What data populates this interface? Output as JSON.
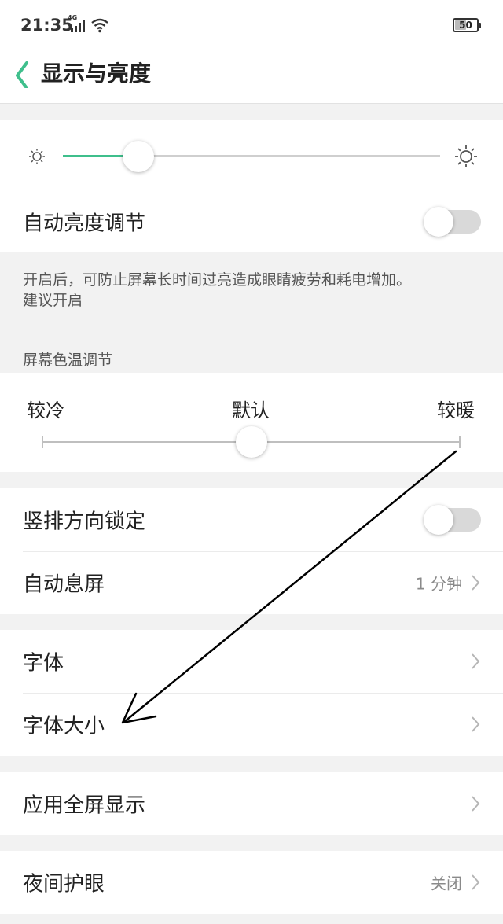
{
  "status_bar": {
    "time": "21:35",
    "network": "4G",
    "battery": "50"
  },
  "header": {
    "title": "显示与亮度"
  },
  "brightness": {
    "level": 0.2,
    "auto_label": "自动亮度调节",
    "auto_enabled": false
  },
  "auto_note": {
    "line1": "开启后，可防止屏幕长时间过亮造成眼睛疲劳和耗电增加。",
    "line2": "建议开启"
  },
  "color_temp": {
    "title": "屏幕色温调节",
    "cool": "较冷",
    "default": "默认",
    "warm": "较暖",
    "level": 0.5
  },
  "orientation": {
    "label": "竖排方向锁定",
    "enabled": false
  },
  "auto_sleep": {
    "label": "自动息屏",
    "value": "1 分钟"
  },
  "font": {
    "label": "字体"
  },
  "font_size": {
    "label": "字体大小"
  },
  "fullscreen": {
    "label": "应用全屏显示"
  },
  "night_mode": {
    "label": "夜间护眼",
    "value": "关闭"
  },
  "colors": {
    "accent": "#3fbf8c",
    "page_bg": "#f2f2f2",
    "annotation_arrow": "#000000"
  }
}
